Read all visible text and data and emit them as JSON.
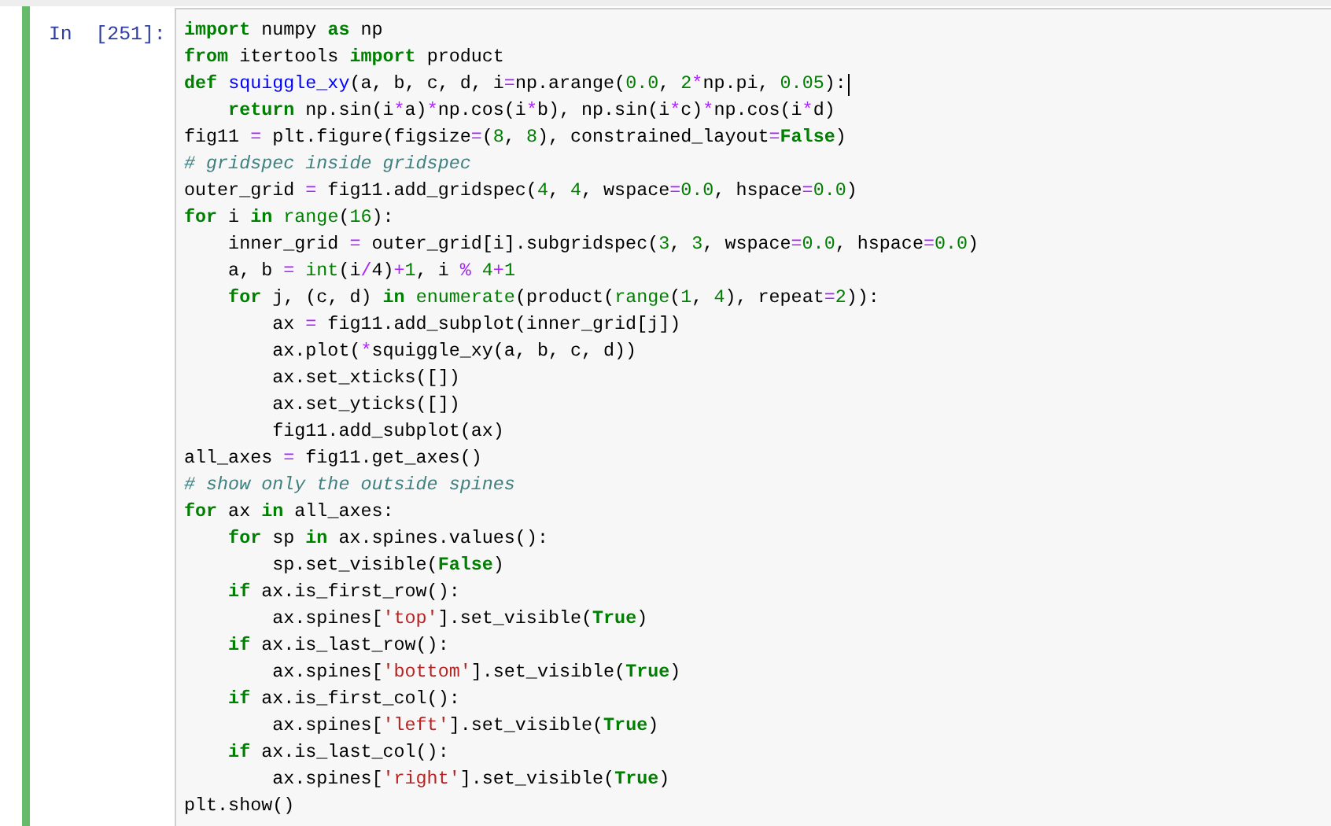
{
  "cell": {
    "prompt": "In  [251]:",
    "selected": true,
    "lines": [
      {
        "cursor": false,
        "segments": [
          {
            "text": "import",
            "kind": "kw"
          },
          {
            "text": " numpy ",
            "kind": "t"
          },
          {
            "text": "as",
            "kind": "kw"
          },
          {
            "text": " np",
            "kind": "t"
          }
        ]
      },
      {
        "cursor": false,
        "segments": [
          {
            "text": "from",
            "kind": "kw"
          },
          {
            "text": " itertools ",
            "kind": "t"
          },
          {
            "text": "import",
            "kind": "kw"
          },
          {
            "text": " product",
            "kind": "t"
          }
        ]
      },
      {
        "cursor": true,
        "segments": [
          {
            "text": "def ",
            "kind": "kw"
          },
          {
            "text": "squiggle_xy",
            "kind": "fn"
          },
          {
            "text": "(a, b, c, d, i",
            "kind": "t"
          },
          {
            "text": "=",
            "kind": "op"
          },
          {
            "text": "np.arange(",
            "kind": "t"
          },
          {
            "text": "0.0",
            "kind": "num"
          },
          {
            "text": ", ",
            "kind": "t"
          },
          {
            "text": "2",
            "kind": "num"
          },
          {
            "text": "*",
            "kind": "op"
          },
          {
            "text": "np.pi, ",
            "kind": "t"
          },
          {
            "text": "0.05",
            "kind": "num"
          },
          {
            "text": "):",
            "kind": "t"
          }
        ]
      },
      {
        "cursor": false,
        "segments": [
          {
            "text": "    return",
            "kind": "kw"
          },
          {
            "text": " np.sin(i",
            "kind": "t"
          },
          {
            "text": "*",
            "kind": "op"
          },
          {
            "text": "a)",
            "kind": "t"
          },
          {
            "text": "*",
            "kind": "op"
          },
          {
            "text": "np.cos(i",
            "kind": "t"
          },
          {
            "text": "*",
            "kind": "op"
          },
          {
            "text": "b), np.sin(i",
            "kind": "t"
          },
          {
            "text": "*",
            "kind": "op"
          },
          {
            "text": "c)",
            "kind": "t"
          },
          {
            "text": "*",
            "kind": "op"
          },
          {
            "text": "np.cos(i",
            "kind": "t"
          },
          {
            "text": "*",
            "kind": "op"
          },
          {
            "text": "d)",
            "kind": "t"
          }
        ]
      },
      {
        "cursor": false,
        "segments": [
          {
            "text": "fig11 ",
            "kind": "t"
          },
          {
            "text": "=",
            "kind": "op"
          },
          {
            "text": " plt.figure(figsize",
            "kind": "t"
          },
          {
            "text": "=",
            "kind": "op"
          },
          {
            "text": "(",
            "kind": "t"
          },
          {
            "text": "8",
            "kind": "num"
          },
          {
            "text": ", ",
            "kind": "t"
          },
          {
            "text": "8",
            "kind": "num"
          },
          {
            "text": "), constrained_layout",
            "kind": "t"
          },
          {
            "text": "=",
            "kind": "op"
          },
          {
            "text": "False",
            "kind": "kw"
          },
          {
            "text": ")",
            "kind": "t"
          }
        ]
      },
      {
        "cursor": false,
        "segments": [
          {
            "text": "# gridspec inside gridspec",
            "kind": "cm"
          }
        ]
      },
      {
        "cursor": false,
        "segments": [
          {
            "text": "outer_grid ",
            "kind": "t"
          },
          {
            "text": "=",
            "kind": "op"
          },
          {
            "text": " fig11.add_gridspec(",
            "kind": "t"
          },
          {
            "text": "4",
            "kind": "num"
          },
          {
            "text": ", ",
            "kind": "t"
          },
          {
            "text": "4",
            "kind": "num"
          },
          {
            "text": ", wspace",
            "kind": "t"
          },
          {
            "text": "=",
            "kind": "op"
          },
          {
            "text": "0.0",
            "kind": "num"
          },
          {
            "text": ", hspace",
            "kind": "t"
          },
          {
            "text": "=",
            "kind": "op"
          },
          {
            "text": "0.0",
            "kind": "num"
          },
          {
            "text": ")",
            "kind": "t"
          }
        ]
      },
      {
        "cursor": false,
        "segments": [
          {
            "text": "for",
            "kind": "kw"
          },
          {
            "text": " i ",
            "kind": "t"
          },
          {
            "text": "in ",
            "kind": "kw"
          },
          {
            "text": "range",
            "kind": "bi"
          },
          {
            "text": "(",
            "kind": "t"
          },
          {
            "text": "16",
            "kind": "num"
          },
          {
            "text": "):",
            "kind": "t"
          }
        ]
      },
      {
        "cursor": false,
        "segments": [
          {
            "text": "    inner_grid ",
            "kind": "t"
          },
          {
            "text": "=",
            "kind": "op"
          },
          {
            "text": " outer_grid[i].subgridspec(",
            "kind": "t"
          },
          {
            "text": "3",
            "kind": "num"
          },
          {
            "text": ", ",
            "kind": "t"
          },
          {
            "text": "3",
            "kind": "num"
          },
          {
            "text": ", wspace",
            "kind": "t"
          },
          {
            "text": "=",
            "kind": "op"
          },
          {
            "text": "0.0",
            "kind": "num"
          },
          {
            "text": ", hspace",
            "kind": "t"
          },
          {
            "text": "=",
            "kind": "op"
          },
          {
            "text": "0.0",
            "kind": "num"
          },
          {
            "text": ")",
            "kind": "t"
          }
        ]
      },
      {
        "cursor": false,
        "segments": [
          {
            "text": "    a, b ",
            "kind": "t"
          },
          {
            "text": "=",
            "kind": "op"
          },
          {
            "text": " int",
            "kind": "bi"
          },
          {
            "text": "(i",
            "kind": "t"
          },
          {
            "text": "/",
            "kind": "op"
          },
          {
            "text": "4)",
            "kind": "t"
          },
          {
            "text": "+",
            "kind": "op"
          },
          {
            "text": "1",
            "kind": "num"
          },
          {
            "text": ", i ",
            "kind": "t"
          },
          {
            "text": "%",
            "kind": "op"
          },
          {
            "text": " 4",
            "kind": "num"
          },
          {
            "text": "+",
            "kind": "op"
          },
          {
            "text": "1",
            "kind": "num"
          }
        ]
      },
      {
        "cursor": false,
        "segments": [
          {
            "text": "    for",
            "kind": "kw"
          },
          {
            "text": " j, (c, d) ",
            "kind": "t"
          },
          {
            "text": "in ",
            "kind": "kw"
          },
          {
            "text": "enumerate",
            "kind": "bi"
          },
          {
            "text": "(product(",
            "kind": "t"
          },
          {
            "text": "range",
            "kind": "bi"
          },
          {
            "text": "(",
            "kind": "t"
          },
          {
            "text": "1",
            "kind": "num"
          },
          {
            "text": ", ",
            "kind": "t"
          },
          {
            "text": "4",
            "kind": "num"
          },
          {
            "text": "), repeat",
            "kind": "t"
          },
          {
            "text": "=",
            "kind": "op"
          },
          {
            "text": "2",
            "kind": "num"
          },
          {
            "text": ")):",
            "kind": "t"
          }
        ]
      },
      {
        "cursor": false,
        "segments": [
          {
            "text": "        ax ",
            "kind": "t"
          },
          {
            "text": "=",
            "kind": "op"
          },
          {
            "text": " fig11.add_subplot(inner_grid[j])",
            "kind": "t"
          }
        ]
      },
      {
        "cursor": false,
        "segments": [
          {
            "text": "        ax.plot(",
            "kind": "t"
          },
          {
            "text": "*",
            "kind": "op"
          },
          {
            "text": "squiggle_xy(a, b, c, d))",
            "kind": "t"
          }
        ]
      },
      {
        "cursor": false,
        "segments": [
          {
            "text": "        ax.set_xticks([])",
            "kind": "t"
          }
        ]
      },
      {
        "cursor": false,
        "segments": [
          {
            "text": "        ax.set_yticks([])",
            "kind": "t"
          }
        ]
      },
      {
        "cursor": false,
        "segments": [
          {
            "text": "        fig11.add_subplot(ax)",
            "kind": "t"
          }
        ]
      },
      {
        "cursor": false,
        "segments": [
          {
            "text": "all_axes ",
            "kind": "t"
          },
          {
            "text": "=",
            "kind": "op"
          },
          {
            "text": " fig11.get_axes()",
            "kind": "t"
          }
        ]
      },
      {
        "cursor": false,
        "segments": [
          {
            "text": "# show only the outside spines",
            "kind": "cm"
          }
        ]
      },
      {
        "cursor": false,
        "segments": [
          {
            "text": "for",
            "kind": "kw"
          },
          {
            "text": " ax ",
            "kind": "t"
          },
          {
            "text": "in",
            "kind": "kw"
          },
          {
            "text": " all_axes:",
            "kind": "t"
          }
        ]
      },
      {
        "cursor": false,
        "segments": [
          {
            "text": "    for",
            "kind": "kw"
          },
          {
            "text": " sp ",
            "kind": "t"
          },
          {
            "text": "in",
            "kind": "kw"
          },
          {
            "text": " ax.spines.values():",
            "kind": "t"
          }
        ]
      },
      {
        "cursor": false,
        "segments": [
          {
            "text": "        sp.set_visible(",
            "kind": "t"
          },
          {
            "text": "False",
            "kind": "kw"
          },
          {
            "text": ")",
            "kind": "t"
          }
        ]
      },
      {
        "cursor": false,
        "segments": [
          {
            "text": "    if",
            "kind": "kw"
          },
          {
            "text": " ax.is_first_row():",
            "kind": "t"
          }
        ]
      },
      {
        "cursor": false,
        "segments": [
          {
            "text": "        ax.spines[",
            "kind": "t"
          },
          {
            "text": "'top'",
            "kind": "str"
          },
          {
            "text": "].set_visible(",
            "kind": "t"
          },
          {
            "text": "True",
            "kind": "kw"
          },
          {
            "text": ")",
            "kind": "t"
          }
        ]
      },
      {
        "cursor": false,
        "segments": [
          {
            "text": "    if",
            "kind": "kw"
          },
          {
            "text": " ax.is_last_row():",
            "kind": "t"
          }
        ]
      },
      {
        "cursor": false,
        "segments": [
          {
            "text": "        ax.spines[",
            "kind": "t"
          },
          {
            "text": "'bottom'",
            "kind": "str"
          },
          {
            "text": "].set_visible(",
            "kind": "t"
          },
          {
            "text": "True",
            "kind": "kw"
          },
          {
            "text": ")",
            "kind": "t"
          }
        ]
      },
      {
        "cursor": false,
        "segments": [
          {
            "text": "    if",
            "kind": "kw"
          },
          {
            "text": " ax.is_first_col():",
            "kind": "t"
          }
        ]
      },
      {
        "cursor": false,
        "segments": [
          {
            "text": "        ax.spines[",
            "kind": "t"
          },
          {
            "text": "'left'",
            "kind": "str"
          },
          {
            "text": "].set_visible(",
            "kind": "t"
          },
          {
            "text": "True",
            "kind": "kw"
          },
          {
            "text": ")",
            "kind": "t"
          }
        ]
      },
      {
        "cursor": false,
        "segments": [
          {
            "text": "    if",
            "kind": "kw"
          },
          {
            "text": " ax.is_last_col():",
            "kind": "t"
          }
        ]
      },
      {
        "cursor": false,
        "segments": [
          {
            "text": "        ax.spines[",
            "kind": "t"
          },
          {
            "text": "'right'",
            "kind": "str"
          },
          {
            "text": "].set_visible(",
            "kind": "t"
          },
          {
            "text": "True",
            "kind": "kw"
          },
          {
            "text": ")",
            "kind": "t"
          }
        ]
      },
      {
        "cursor": false,
        "segments": [
          {
            "text": "plt.show()",
            "kind": "t"
          }
        ]
      }
    ]
  }
}
